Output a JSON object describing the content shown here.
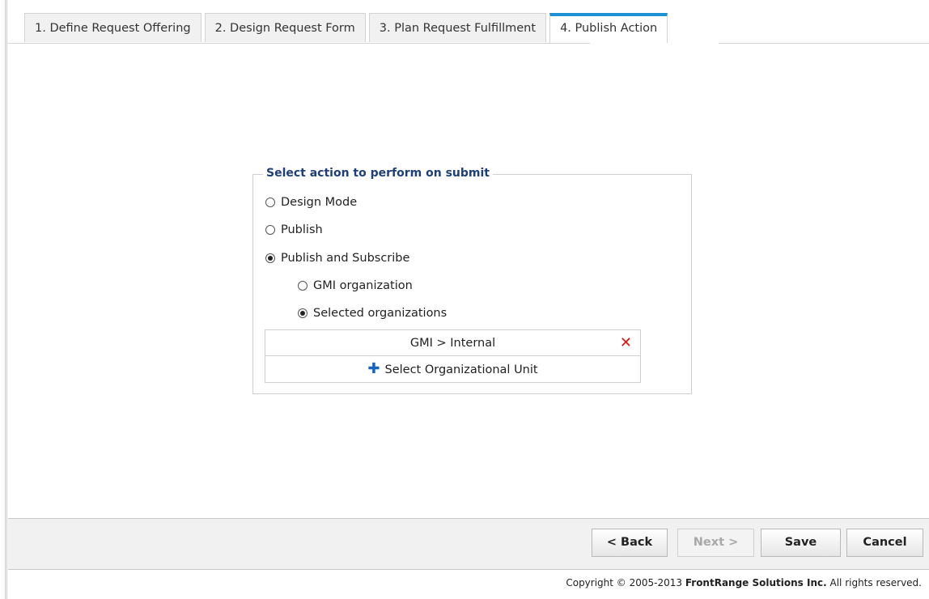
{
  "tabs": [
    {
      "label": "1. Define Request Offering",
      "active": false
    },
    {
      "label": "2. Design Request Form",
      "active": false
    },
    {
      "label": "3. Plan Request Fulfillment",
      "active": false
    },
    {
      "label": "4. Publish Action",
      "active": true
    }
  ],
  "action_panel": {
    "legend": "Select action to perform on submit",
    "options": [
      {
        "label": "Design Mode",
        "checked": false
      },
      {
        "label": "Publish",
        "checked": false
      },
      {
        "label": "Publish and Subscribe",
        "checked": true
      }
    ],
    "sub_options": [
      {
        "label": "GMI organization",
        "checked": false
      },
      {
        "label": "Selected organizations",
        "checked": true
      }
    ],
    "organizations": [
      "GMI > Internal"
    ],
    "add_label": "Select Organizational Unit"
  },
  "buttons": {
    "back": "< Back",
    "next": "Next >",
    "save": "Save",
    "cancel": "Cancel"
  },
  "footer": {
    "prefix": "Copyright © 2005-2013 ",
    "company": "FrontRange Solutions Inc.",
    "suffix": " All rights reserved."
  },
  "colors": {
    "active_tab_accent": "#1e90d6",
    "legend_text": "#1f3f7a",
    "remove_icon": "#e01010",
    "add_icon": "#1565c0"
  }
}
